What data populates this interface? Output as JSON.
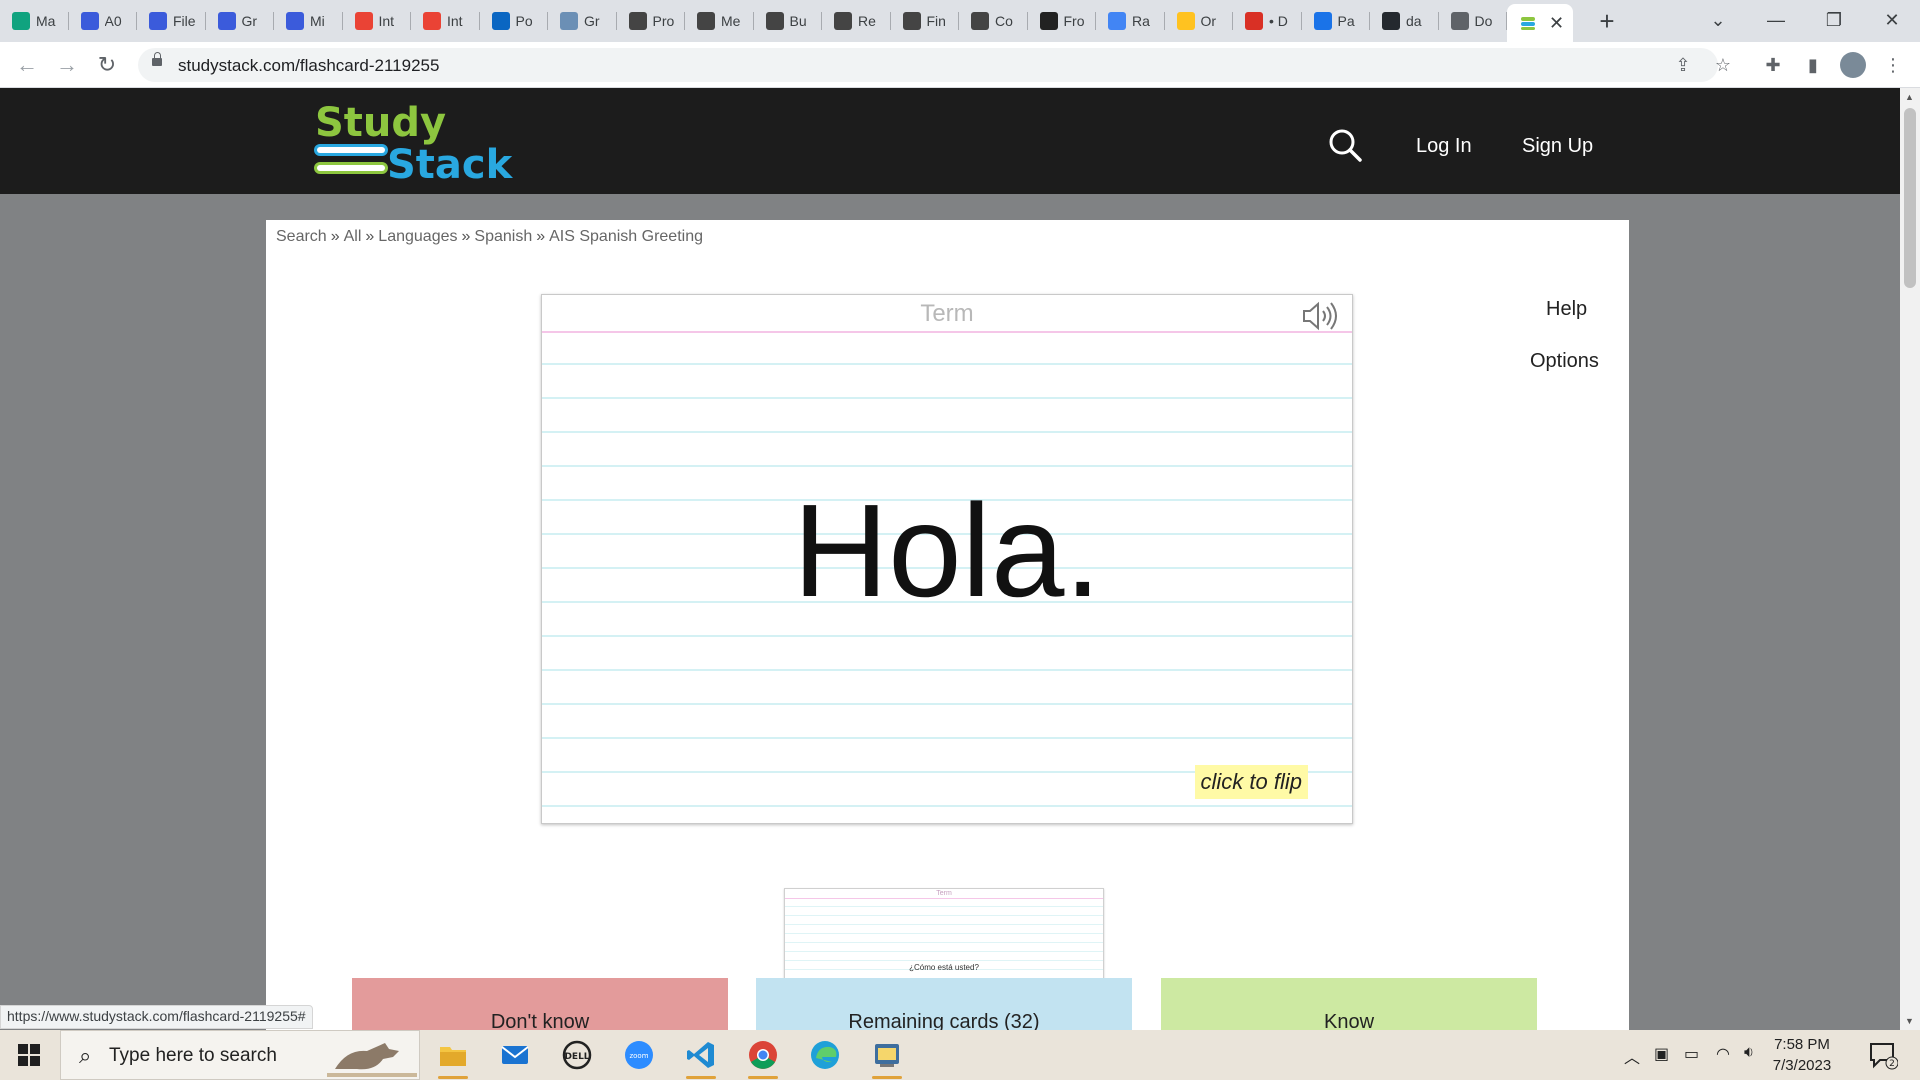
{
  "browser": {
    "tabs": [
      {
        "label": "Ma",
        "icon": "openai-icon",
        "color": "#10a37f"
      },
      {
        "label": "A0",
        "icon": "app-icon",
        "color": "#3b5bdb"
      },
      {
        "label": "File",
        "icon": "app-icon",
        "color": "#3b5bdb"
      },
      {
        "label": "Gr",
        "icon": "app-icon",
        "color": "#3b5bdb"
      },
      {
        "label": "Mi",
        "icon": "app-icon",
        "color": "#3b5bdb"
      },
      {
        "label": "Int",
        "icon": "gmail-icon",
        "color": "#ea4335"
      },
      {
        "label": "Int",
        "icon": "gmail-icon",
        "color": "#ea4335"
      },
      {
        "label": "Po",
        "icon": "linkedin-icon",
        "color": "#0a66c2"
      },
      {
        "label": "Gr",
        "icon": "book-icon",
        "color": "#6b8fb5"
      },
      {
        "label": "Pro",
        "icon": "app-icon",
        "color": "#444444"
      },
      {
        "label": "Me",
        "icon": "app-icon",
        "color": "#444444"
      },
      {
        "label": "Bu",
        "icon": "app-icon",
        "color": "#444444"
      },
      {
        "label": "Re",
        "icon": "app-icon",
        "color": "#444444"
      },
      {
        "label": "Fin",
        "icon": "app-icon",
        "color": "#444444"
      },
      {
        "label": "Co",
        "icon": "app-icon",
        "color": "#444444"
      },
      {
        "label": "Fro",
        "icon": "code-icon",
        "color": "#222222"
      },
      {
        "label": "Ra",
        "icon": "google-icon",
        "color": "#4285f4"
      },
      {
        "label": "Or",
        "icon": "walmart-icon",
        "color": "#ffc220"
      },
      {
        "label": "• D",
        "icon": "record-icon",
        "color": "#d93025"
      },
      {
        "label": "Pa",
        "icon": "zoho-icon",
        "color": "#1a73e8"
      },
      {
        "label": "da",
        "icon": "github-icon",
        "color": "#24292f"
      },
      {
        "label": "Do",
        "icon": "globe-icon",
        "color": "#5f6368"
      }
    ],
    "active_tab": {
      "icon": "studystack-icon"
    },
    "url": "studystack.com/flashcard-2119255",
    "status_url": "https://www.studystack.com/flashcard-2119255#"
  },
  "site": {
    "logo_top": "Study",
    "logo_bottom": "Stack",
    "login": "Log In",
    "signup": "Sign Up"
  },
  "breadcrumb": [
    {
      "label": "Search"
    },
    {
      "label": "All"
    },
    {
      "label": "Languages"
    },
    {
      "label": "Spanish"
    },
    {
      "label": "AIS Spanish Greeting"
    }
  ],
  "breadcrumb_sep": "»",
  "card": {
    "header": "Term",
    "text": "Hola.",
    "flip_hint": "click to flip"
  },
  "next_card": {
    "header": "Term",
    "text": "¿Cómo está usted?"
  },
  "actions": {
    "dont_know": "Don't know",
    "remaining": "Remaining cards (32)",
    "know": "Know"
  },
  "side": {
    "help": "Help",
    "options": "Options"
  },
  "taskbar": {
    "search_placeholder": "Type here to search",
    "time": "7:58 PM",
    "date": "7/3/2023",
    "notifications": "2"
  }
}
